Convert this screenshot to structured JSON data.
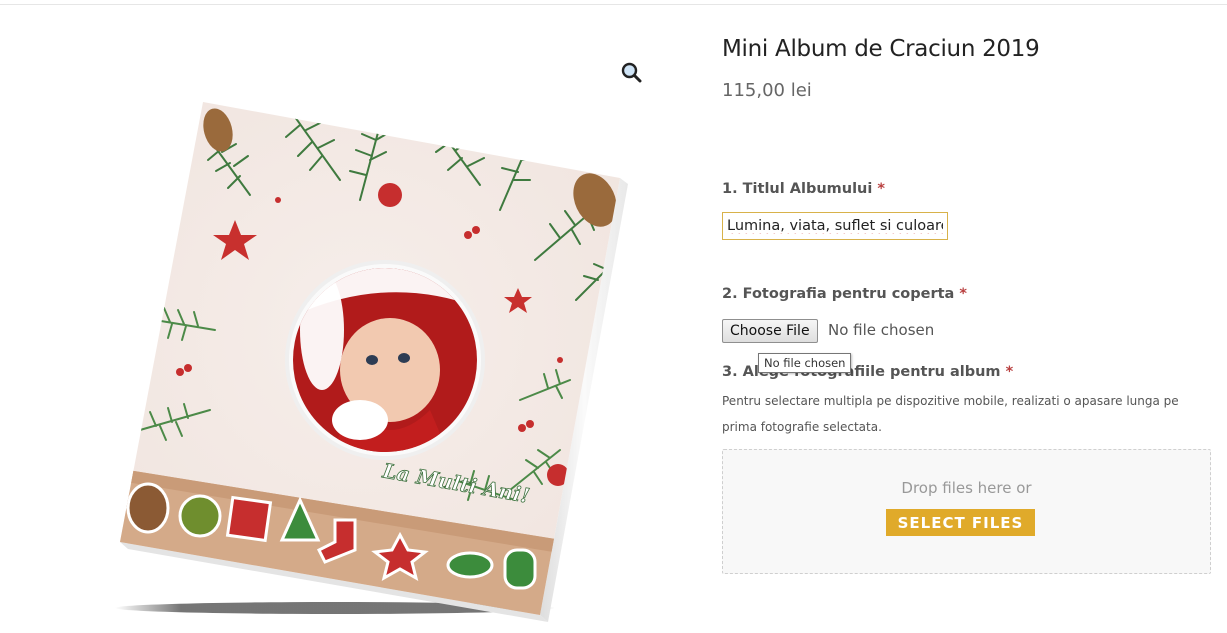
{
  "product": {
    "title": "Mini Album de Craciun 2019",
    "price": "115,00 lei"
  },
  "gallery": {
    "zoom_icon": "magnifier-icon",
    "album_banner_text": "La Multi Ani!"
  },
  "fields": {
    "album_title": {
      "label": "1. Titlul Albumului",
      "required_mark": "*",
      "value": "Lumina, viata, suflet si culoare"
    },
    "cover_photo": {
      "label": "2. Fotografia pentru coperta",
      "required_mark": "*",
      "button_label": "Choose File",
      "status": "No file chosen",
      "tooltip": "No file chosen"
    },
    "album_photos": {
      "label": "3. Alege fotografiile pentru album",
      "required_mark": "*",
      "description": "Pentru selectare multipla pe dispozitive mobile, realizati o apasare lunga pe prima fotografie selectata.",
      "drop_text": "Drop files here or",
      "select_button": "SELECT FILES"
    }
  },
  "colors": {
    "accent": "#e0aa2a",
    "input_border": "#d8b24a",
    "required": "#b94040"
  }
}
